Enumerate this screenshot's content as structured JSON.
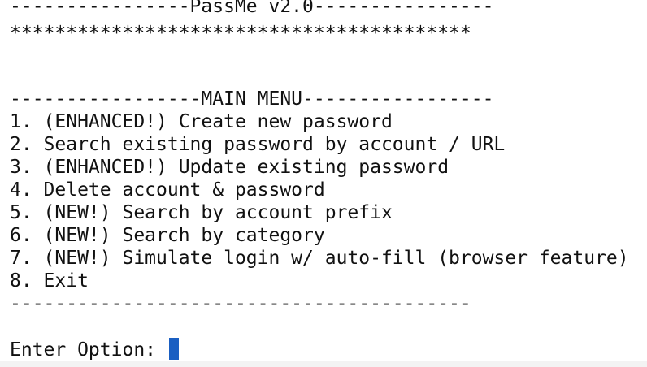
{
  "header": {
    "title_rule": "----------------PassMe v2.0----------------",
    "stars": "*****************************************"
  },
  "menu": {
    "title_rule": "-----------------MAIN MENU-----------------",
    "items": [
      "1. (ENHANCED!) Create new password",
      "2. Search existing password by account / URL",
      "3. (ENHANCED!) Update existing password",
      "4. Delete account & password",
      "5. (NEW!) Search by account prefix",
      "6. (NEW!) Search by category",
      "7. (NEW!) Simulate login w/ auto-fill (browser feature)",
      "8. Exit"
    ],
    "bottom_rule": "-----------------------------------------"
  },
  "prompt": {
    "label": "Enter Option: "
  },
  "colors": {
    "text": "#111111",
    "background": "#ffffff",
    "cursor": "#1a5fc2"
  }
}
